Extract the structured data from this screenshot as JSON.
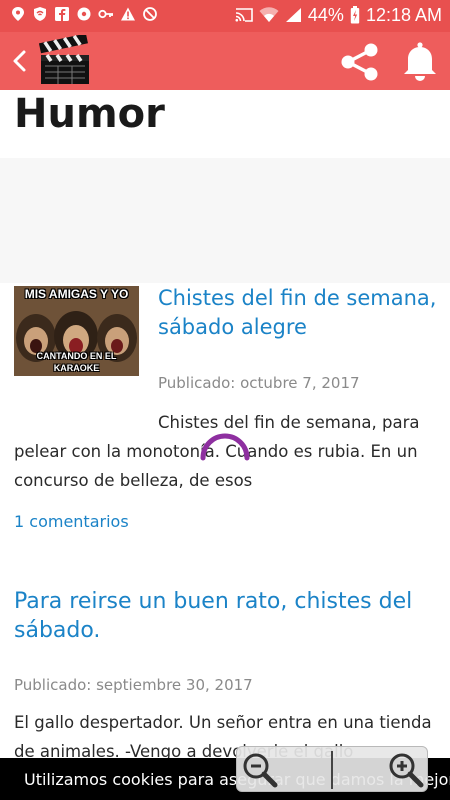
{
  "status_bar": {
    "battery": "44%",
    "time": "12:18 AM",
    "icons": [
      "location-icon",
      "vpn-icon",
      "facebook-icon",
      "settings-icon",
      "key-icon",
      "warning-icon",
      "block-icon",
      "cast-icon",
      "wifi-icon",
      "signal-icon",
      "battery-icon"
    ]
  },
  "app_bar": {
    "icons": [
      "back-icon",
      "clapperboard-logo",
      "share-icon",
      "bell-icon"
    ]
  },
  "page": {
    "title": "Humor"
  },
  "posts": [
    {
      "title": "Chistes del fin de semana, sábado alegre",
      "date": "Publicado: octubre 7, 2017",
      "excerpt": "Chistes del fin de semana, para pelear con la monotonía. Cuando es rubia. En un concurso de belleza, de esos",
      "comments": "1 comentarios",
      "thumbnail": {
        "top_text": "MIS AMIGAS Y YO",
        "bottom_text": "CANTANDO EN EL KARAOKE"
      }
    },
    {
      "title": "Para reirse un buen rato, chistes del sábado.",
      "date": "Publicado: septiembre 30, 2017",
      "excerpt": "El gallo despertador. Un señor entra en una tienda de animales. -Vengo a devolverle el gallo"
    }
  ],
  "cookie_bar": {
    "text": "Utilizamos cookies para asegurar que damos la mejor experiencia"
  },
  "colors": {
    "accent": "#ee5d5c",
    "statusbar": "#e8504f",
    "link": "#1b83c7",
    "spinner": "#8e2fa0"
  }
}
